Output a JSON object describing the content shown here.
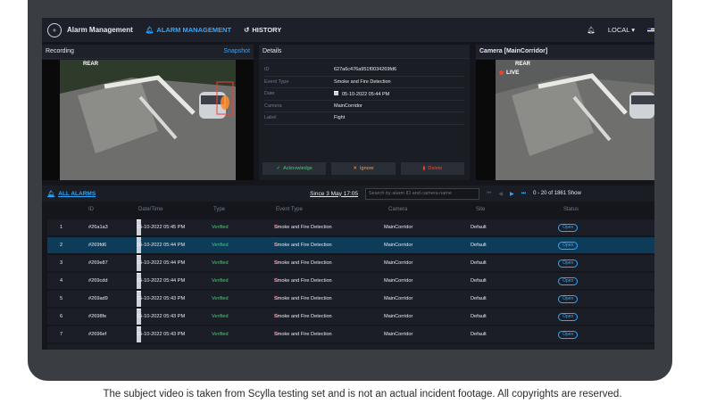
{
  "nav": {
    "app_title": "Alarm Management",
    "links": [
      "ALARM MANAGEMENT",
      "HISTORY"
    ],
    "locale": "LOCAL"
  },
  "recording": {
    "title": "Recording",
    "snapshot": "Snapshot",
    "overlay": "REAR"
  },
  "details": {
    "title": "Details",
    "rows": [
      {
        "key": "ID",
        "value": "627a6c476a951f0034269fd6"
      },
      {
        "key": "Event Type",
        "value": "Smoke and Fire Detection"
      },
      {
        "key": "Date",
        "value": "05-10-2022 05:44 PM"
      },
      {
        "key": "Camera",
        "value": "MainCorridor"
      },
      {
        "key": "Label",
        "value": "Fight"
      }
    ],
    "actions": {
      "acknowledge": "Acknowledge",
      "ignore": "Ignore",
      "delete": "Delete"
    },
    "colors": {
      "acknowledge": "#38d36a",
      "ignore": "#ff9f43",
      "delete": "#ff3b30"
    }
  },
  "camera": {
    "title": "Camera [MainCorridor]",
    "overlay": "REAR",
    "live": "LIVE"
  },
  "alarms": {
    "all_label": "ALL ALARMS",
    "since": "Since 3 May 17:05",
    "search_placeholder": "Search by alarm ID and camera name",
    "range": "0 - 20 of 1861",
    "show": "Show"
  },
  "table": {
    "headers": [
      "ID",
      "Date/Time",
      "Type",
      "Event Type",
      "Camera",
      "Site",
      "Status"
    ],
    "rows": [
      {
        "n": "1",
        "id": "#26a1a3",
        "date": "05-10-2022 05:45 PM",
        "type": "Verified",
        "event": "Smoke and Fire Detection",
        "camera": "MainCorridor",
        "site": "Default",
        "status": "Open"
      },
      {
        "n": "2",
        "id": "#269fd6",
        "date": "05-10-2022 05:44 PM",
        "type": "Verified",
        "event": "Smoke and Fire Detection",
        "camera": "MainCorridor",
        "site": "Default",
        "status": "Open"
      },
      {
        "n": "3",
        "id": "#269e87",
        "date": "05-10-2022 05:44 PM",
        "type": "Verified",
        "event": "Smoke and Fire Detection",
        "camera": "MainCorridor",
        "site": "Default",
        "status": "Open"
      },
      {
        "n": "4",
        "id": "#269cdd",
        "date": "05-10-2022 05:44 PM",
        "type": "Verified",
        "event": "Smoke and Fire Detection",
        "camera": "MainCorridor",
        "site": "Default",
        "status": "Open"
      },
      {
        "n": "5",
        "id": "#269ad9",
        "date": "05-10-2022 05:43 PM",
        "type": "Verified",
        "event": "Smoke and Fire Detection",
        "camera": "MainCorridor",
        "site": "Default",
        "status": "Open"
      },
      {
        "n": "6",
        "id": "#2698fe",
        "date": "05-10-2022 05:43 PM",
        "type": "Verified",
        "event": "Smoke and Fire Detection",
        "camera": "MainCorridor",
        "site": "Default",
        "status": "Open"
      },
      {
        "n": "7",
        "id": "#2696ef",
        "date": "05-10-2022 05:43 PM",
        "type": "Verified",
        "event": "Smoke and Fire Detection",
        "camera": "MainCorridor",
        "site": "Default",
        "status": "Open"
      }
    ]
  },
  "caption": "The subject video is taken from Scylla testing set and is not an actual incident footage. All copyrights are reserved."
}
